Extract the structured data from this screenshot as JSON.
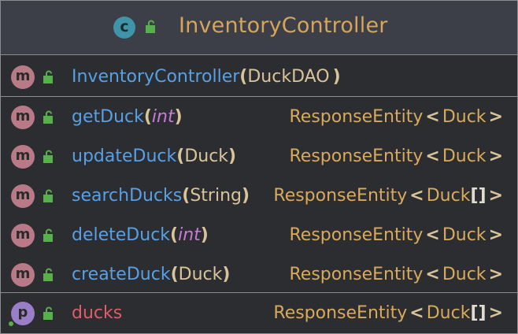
{
  "class": {
    "title": "InventoryController",
    "kind_letter": "c",
    "colors": {
      "header_bg": "#3c3f47",
      "title": "#d6a55a",
      "class_icon": "#3f94aa"
    }
  },
  "constructor": {
    "name": "InventoryController",
    "open": "(",
    "param_type": "DuckDAO",
    "close": ")"
  },
  "methods": [
    {
      "name": "getDuck",
      "param_type": "int",
      "primitive": true,
      "ret_type": "ResponseEntity",
      "ret_generic": "Duck",
      "ret_array": ""
    },
    {
      "name": "updateDuck",
      "param_type": "Duck",
      "primitive": false,
      "ret_type": "ResponseEntity",
      "ret_generic": "Duck",
      "ret_array": ""
    },
    {
      "name": "searchDucks",
      "param_type": "String",
      "primitive": false,
      "ret_type": "ResponseEntity",
      "ret_generic": "Duck",
      "ret_array": "[]"
    },
    {
      "name": "deleteDuck",
      "param_type": "int",
      "primitive": true,
      "ret_type": "ResponseEntity",
      "ret_generic": "Duck",
      "ret_array": ""
    },
    {
      "name": "createDuck",
      "param_type": "Duck",
      "primitive": false,
      "ret_type": "ResponseEntity",
      "ret_generic": "Duck",
      "ret_array": ""
    }
  ],
  "field": {
    "name": "ducks",
    "ret_type": "ResponseEntity",
    "ret_generic": "Duck",
    "ret_array": "[]"
  },
  "badges": {
    "method": "m",
    "property": "p"
  },
  "punct": {
    "open": "(",
    "close": ")",
    "lt": "<",
    "gt": ">"
  },
  "icons": {
    "class": "class-icon",
    "method": "method-icon",
    "property": "property-icon",
    "visibility": "unlocked-icon"
  }
}
